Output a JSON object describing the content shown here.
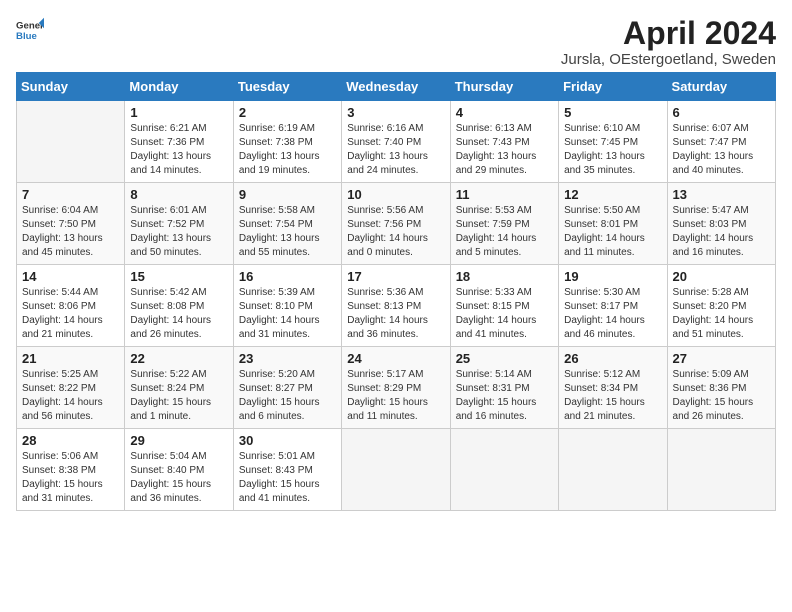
{
  "logo": {
    "general": "General",
    "blue": "Blue"
  },
  "title": {
    "month": "April 2024",
    "location": "Jursla, OEstergoetland, Sweden"
  },
  "weekdays": [
    "Sunday",
    "Monday",
    "Tuesday",
    "Wednesday",
    "Thursday",
    "Friday",
    "Saturday"
  ],
  "weeks": [
    [
      {
        "day": "",
        "info": ""
      },
      {
        "day": "1",
        "info": "Sunrise: 6:21 AM\nSunset: 7:36 PM\nDaylight: 13 hours\nand 14 minutes."
      },
      {
        "day": "2",
        "info": "Sunrise: 6:19 AM\nSunset: 7:38 PM\nDaylight: 13 hours\nand 19 minutes."
      },
      {
        "day": "3",
        "info": "Sunrise: 6:16 AM\nSunset: 7:40 PM\nDaylight: 13 hours\nand 24 minutes."
      },
      {
        "day": "4",
        "info": "Sunrise: 6:13 AM\nSunset: 7:43 PM\nDaylight: 13 hours\nand 29 minutes."
      },
      {
        "day": "5",
        "info": "Sunrise: 6:10 AM\nSunset: 7:45 PM\nDaylight: 13 hours\nand 35 minutes."
      },
      {
        "day": "6",
        "info": "Sunrise: 6:07 AM\nSunset: 7:47 PM\nDaylight: 13 hours\nand 40 minutes."
      }
    ],
    [
      {
        "day": "7",
        "info": "Sunrise: 6:04 AM\nSunset: 7:50 PM\nDaylight: 13 hours\nand 45 minutes."
      },
      {
        "day": "8",
        "info": "Sunrise: 6:01 AM\nSunset: 7:52 PM\nDaylight: 13 hours\nand 50 minutes."
      },
      {
        "day": "9",
        "info": "Sunrise: 5:58 AM\nSunset: 7:54 PM\nDaylight: 13 hours\nand 55 minutes."
      },
      {
        "day": "10",
        "info": "Sunrise: 5:56 AM\nSunset: 7:56 PM\nDaylight: 14 hours\nand 0 minutes."
      },
      {
        "day": "11",
        "info": "Sunrise: 5:53 AM\nSunset: 7:59 PM\nDaylight: 14 hours\nand 5 minutes."
      },
      {
        "day": "12",
        "info": "Sunrise: 5:50 AM\nSunset: 8:01 PM\nDaylight: 14 hours\nand 11 minutes."
      },
      {
        "day": "13",
        "info": "Sunrise: 5:47 AM\nSunset: 8:03 PM\nDaylight: 14 hours\nand 16 minutes."
      }
    ],
    [
      {
        "day": "14",
        "info": "Sunrise: 5:44 AM\nSunset: 8:06 PM\nDaylight: 14 hours\nand 21 minutes."
      },
      {
        "day": "15",
        "info": "Sunrise: 5:42 AM\nSunset: 8:08 PM\nDaylight: 14 hours\nand 26 minutes."
      },
      {
        "day": "16",
        "info": "Sunrise: 5:39 AM\nSunset: 8:10 PM\nDaylight: 14 hours\nand 31 minutes."
      },
      {
        "day": "17",
        "info": "Sunrise: 5:36 AM\nSunset: 8:13 PM\nDaylight: 14 hours\nand 36 minutes."
      },
      {
        "day": "18",
        "info": "Sunrise: 5:33 AM\nSunset: 8:15 PM\nDaylight: 14 hours\nand 41 minutes."
      },
      {
        "day": "19",
        "info": "Sunrise: 5:30 AM\nSunset: 8:17 PM\nDaylight: 14 hours\nand 46 minutes."
      },
      {
        "day": "20",
        "info": "Sunrise: 5:28 AM\nSunset: 8:20 PM\nDaylight: 14 hours\nand 51 minutes."
      }
    ],
    [
      {
        "day": "21",
        "info": "Sunrise: 5:25 AM\nSunset: 8:22 PM\nDaylight: 14 hours\nand 56 minutes."
      },
      {
        "day": "22",
        "info": "Sunrise: 5:22 AM\nSunset: 8:24 PM\nDaylight: 15 hours\nand 1 minute."
      },
      {
        "day": "23",
        "info": "Sunrise: 5:20 AM\nSunset: 8:27 PM\nDaylight: 15 hours\nand 6 minutes."
      },
      {
        "day": "24",
        "info": "Sunrise: 5:17 AM\nSunset: 8:29 PM\nDaylight: 15 hours\nand 11 minutes."
      },
      {
        "day": "25",
        "info": "Sunrise: 5:14 AM\nSunset: 8:31 PM\nDaylight: 15 hours\nand 16 minutes."
      },
      {
        "day": "26",
        "info": "Sunrise: 5:12 AM\nSunset: 8:34 PM\nDaylight: 15 hours\nand 21 minutes."
      },
      {
        "day": "27",
        "info": "Sunrise: 5:09 AM\nSunset: 8:36 PM\nDaylight: 15 hours\nand 26 minutes."
      }
    ],
    [
      {
        "day": "28",
        "info": "Sunrise: 5:06 AM\nSunset: 8:38 PM\nDaylight: 15 hours\nand 31 minutes."
      },
      {
        "day": "29",
        "info": "Sunrise: 5:04 AM\nSunset: 8:40 PM\nDaylight: 15 hours\nand 36 minutes."
      },
      {
        "day": "30",
        "info": "Sunrise: 5:01 AM\nSunset: 8:43 PM\nDaylight: 15 hours\nand 41 minutes."
      },
      {
        "day": "",
        "info": ""
      },
      {
        "day": "",
        "info": ""
      },
      {
        "day": "",
        "info": ""
      },
      {
        "day": "",
        "info": ""
      }
    ]
  ]
}
